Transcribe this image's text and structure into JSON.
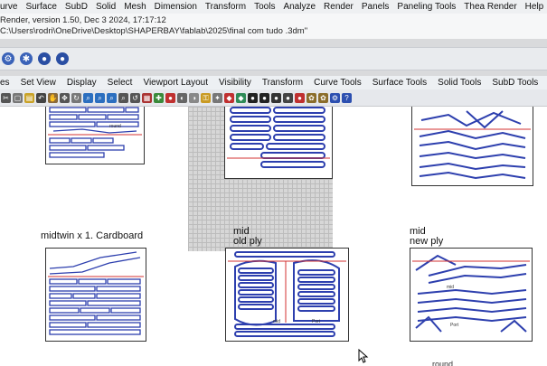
{
  "menubar": {
    "items": [
      "urve",
      "Surface",
      "SubD",
      "Solid",
      "Mesh",
      "Dimension",
      "Transform",
      "Tools",
      "Analyze",
      "Render",
      "Panels",
      "Paneling Tools",
      "Thea Render",
      "Help"
    ]
  },
  "cmdline": {
    "line1": "Render, version 1.50, Dec  3 2024, 17:17:12",
    "line2": "C:\\Users\\rodri\\OneDrive\\Desktop\\SHAPERBAY\\fablab\\2025\\final com tudo .3dm\""
  },
  "tabs": [
    "es",
    "Set View",
    "Display",
    "Select",
    "Viewport Layout",
    "Visibility",
    "Transform",
    "Curve Tools",
    "Surface Tools",
    "Solid Tools",
    "SubD Tools"
  ],
  "viewport": {
    "label_left": "midtwin x 1. Cardboard",
    "label_mid_1": "mid",
    "label_mid_2": "old ply",
    "label_right_1": "mid",
    "label_right_2": "new ply",
    "tag_round": "round",
    "tag_mid": "mid",
    "tag_port": "Port",
    "tag_round_bottom": "round"
  },
  "colors": {
    "panel_blue": "#2d3fae",
    "cut_red": "#d33030"
  }
}
